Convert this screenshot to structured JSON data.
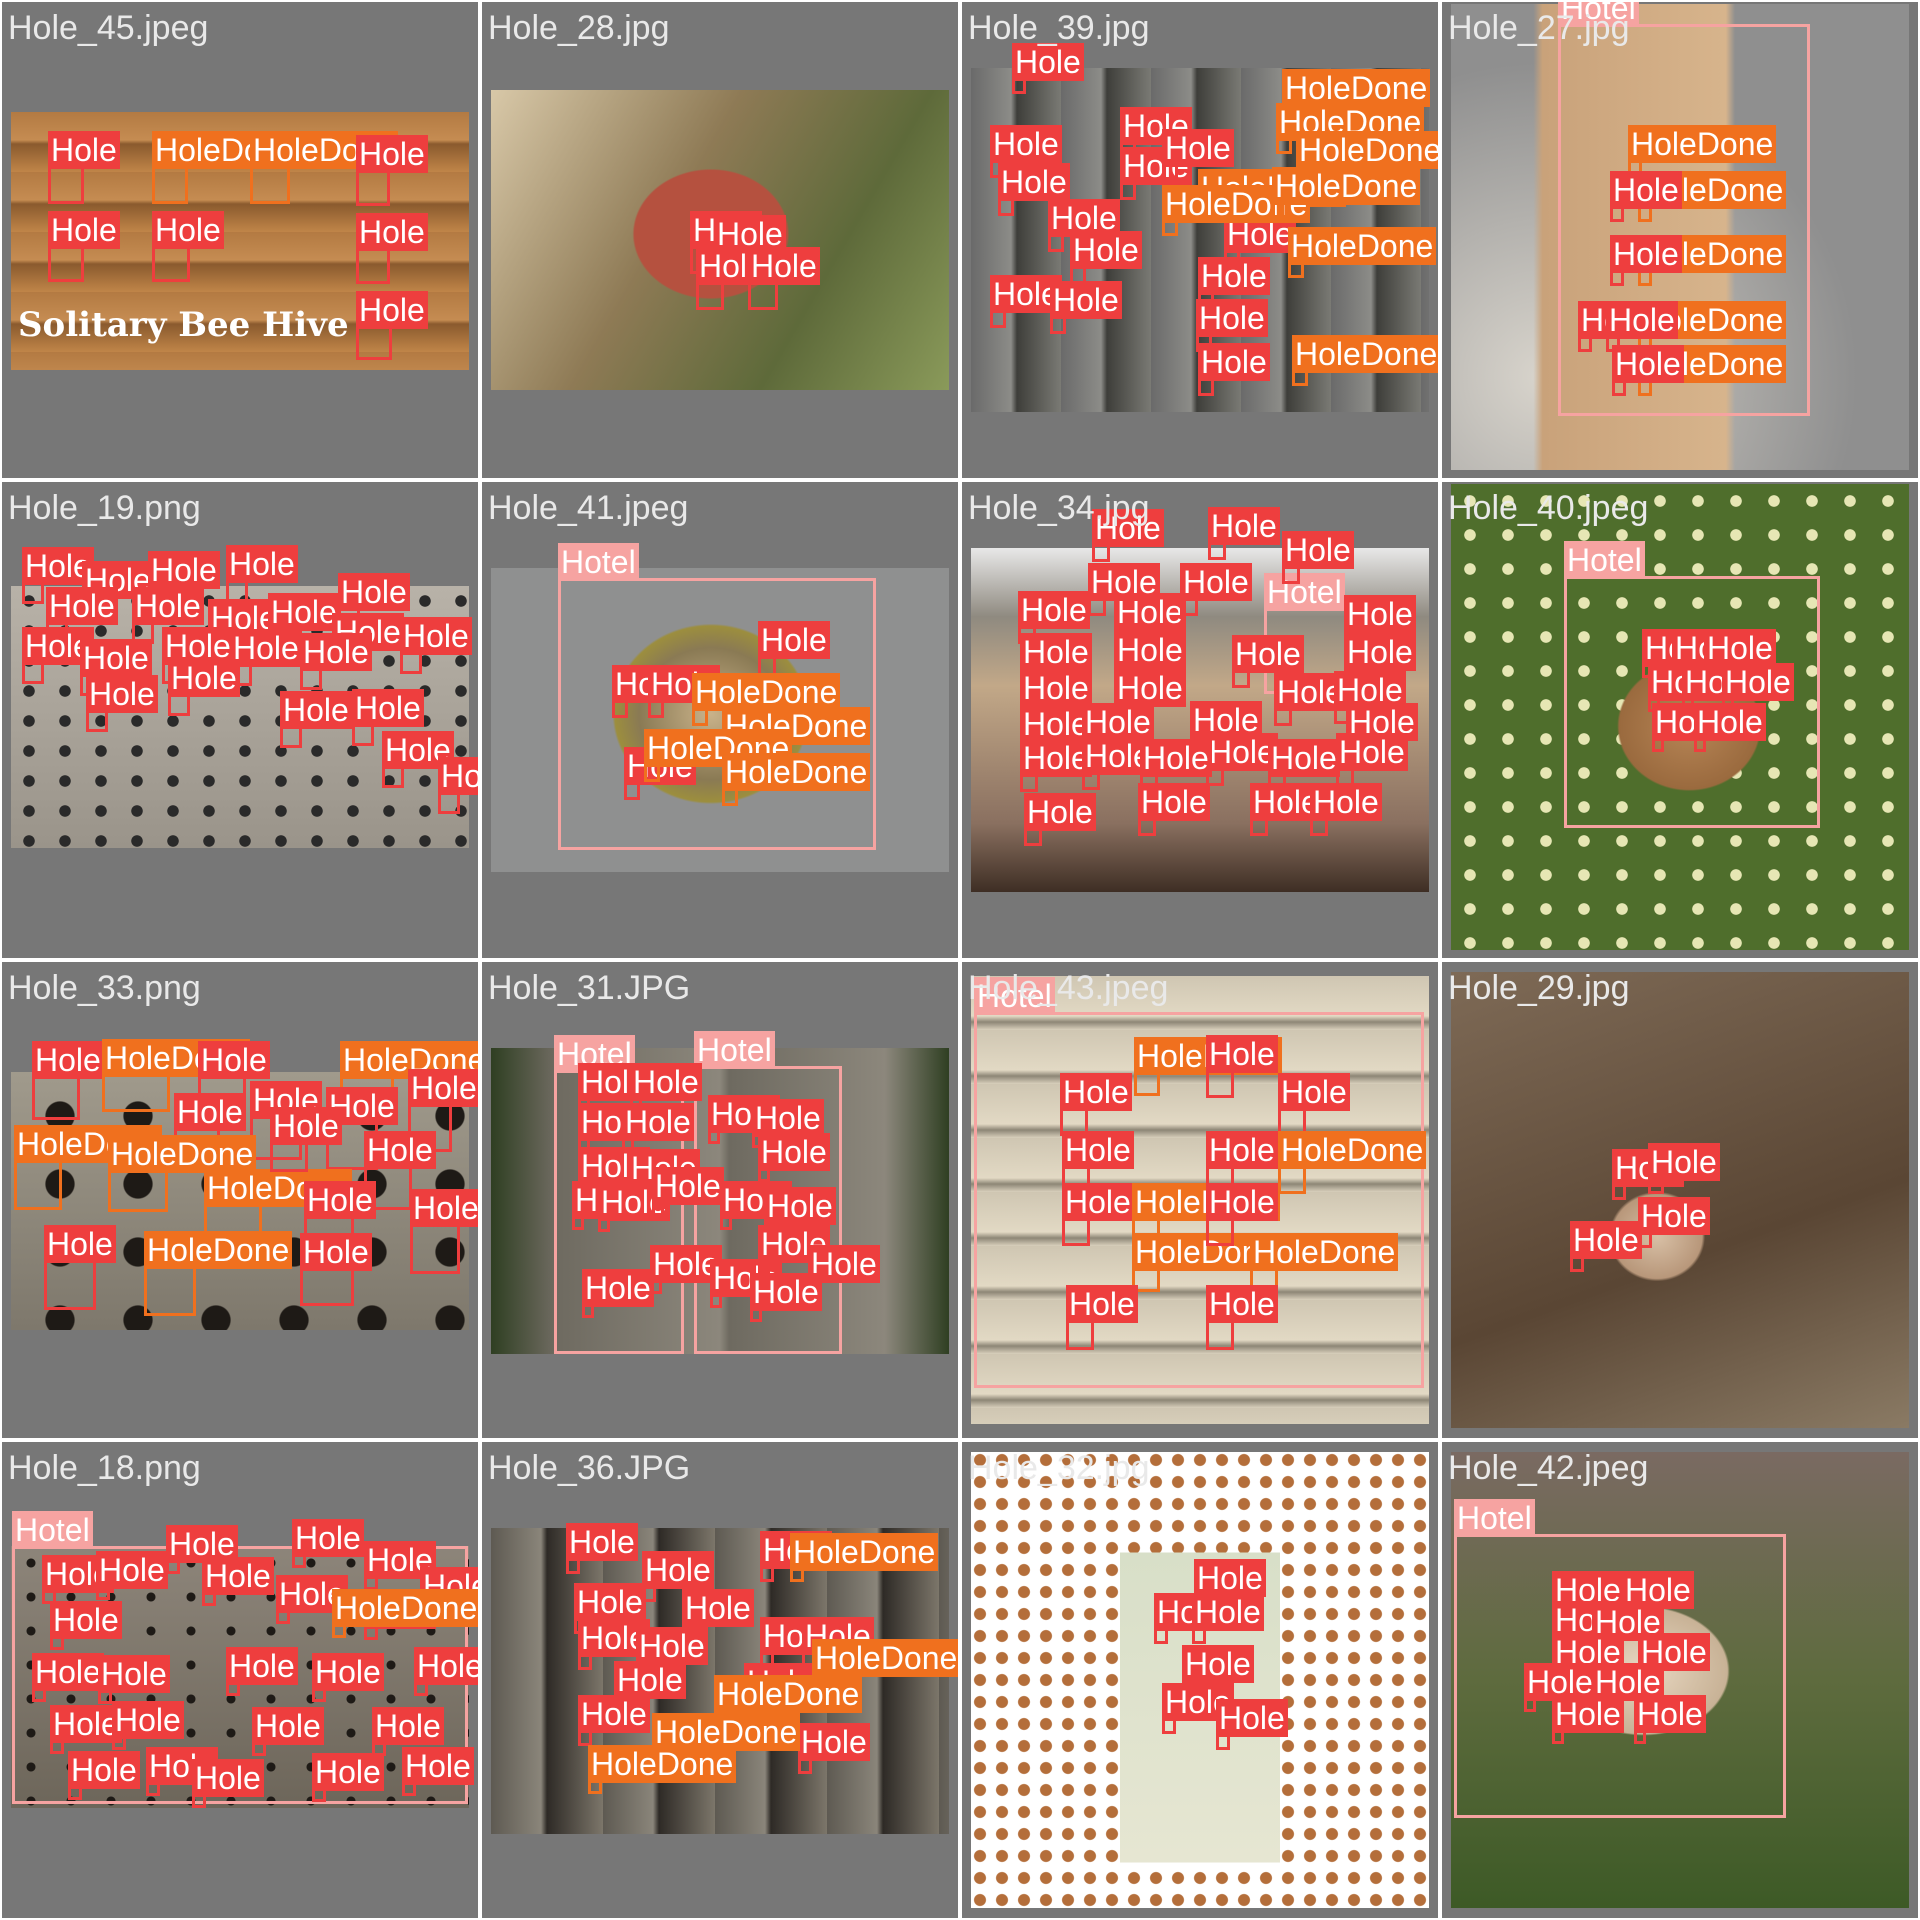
{
  "labels": {
    "hole": "Hole",
    "hole_done": "HoleDone",
    "hotel": "Hotel"
  },
  "colors": {
    "hole": "#ee3e3e",
    "hole_done": "#f0701e",
    "hotel": "#f6a3a1",
    "tile_background": "#777777"
  },
  "tiles": [
    {
      "filename": "Hole_45.jpeg",
      "overlay_text": "Solitary Bee Hive",
      "detections": {
        "Hole": 7,
        "HoleDone": 2,
        "Hotel": 0
      }
    },
    {
      "filename": "Hole_28.jpg",
      "detections": {
        "Hole": 4,
        "HoleDone": 0,
        "Hotel": 0
      }
    },
    {
      "filename": "Hole_39.jpg",
      "detections": {
        "Hole": 14,
        "HoleDone": 8,
        "Hotel": 0
      }
    },
    {
      "filename": "Hole_27.jpg",
      "detections": {
        "Hole": 5,
        "HoleDone": 5,
        "Hotel": 1
      }
    },
    {
      "filename": "Hole_19.png",
      "detections": {
        "Hole": 22,
        "HoleDone": 0,
        "Hotel": 0
      }
    },
    {
      "filename": "Hole_41.jpeg",
      "detections": {
        "Hole": 4,
        "HoleDone": 4,
        "Hotel": 1
      }
    },
    {
      "filename": "Hole_34.jpg",
      "detections": {
        "Hole": 30,
        "HoleDone": 0,
        "Hotel": 1
      }
    },
    {
      "filename": "Hole_40.jpeg",
      "detections": {
        "Hole": 8,
        "HoleDone": 0,
        "Hotel": 1
      }
    },
    {
      "filename": "Hole_33.png",
      "detections": {
        "Hole": 12,
        "HoleDone": 6,
        "Hotel": 0
      }
    },
    {
      "filename": "Hole_31.JPG",
      "detections": {
        "Hole": 20,
        "HoleDone": 0,
        "Hotel": 2
      }
    },
    {
      "filename": "Hole_43.jpeg",
      "detections": {
        "Hole": 9,
        "HoleDone": 5,
        "Hotel": 1
      }
    },
    {
      "filename": "Hole_29.jpg",
      "detections": {
        "Hole": 4,
        "HoleDone": 0,
        "Hotel": 0
      }
    },
    {
      "filename": "Hole_18.png",
      "detections": {
        "Hole": 25,
        "HoleDone": 1,
        "Hotel": 1
      }
    },
    {
      "filename": "Hole_36.JPG",
      "detections": {
        "Hole": 13,
        "HoleDone": 5,
        "Hotel": 0
      }
    },
    {
      "filename": "Hole_32.jpg",
      "detections": {
        "Hole": 6,
        "HoleDone": 0,
        "Hotel": 0
      }
    },
    {
      "filename": "Hole_42.jpeg",
      "detections": {
        "Hole": 10,
        "HoleDone": 0,
        "Hotel": 1
      }
    }
  ]
}
